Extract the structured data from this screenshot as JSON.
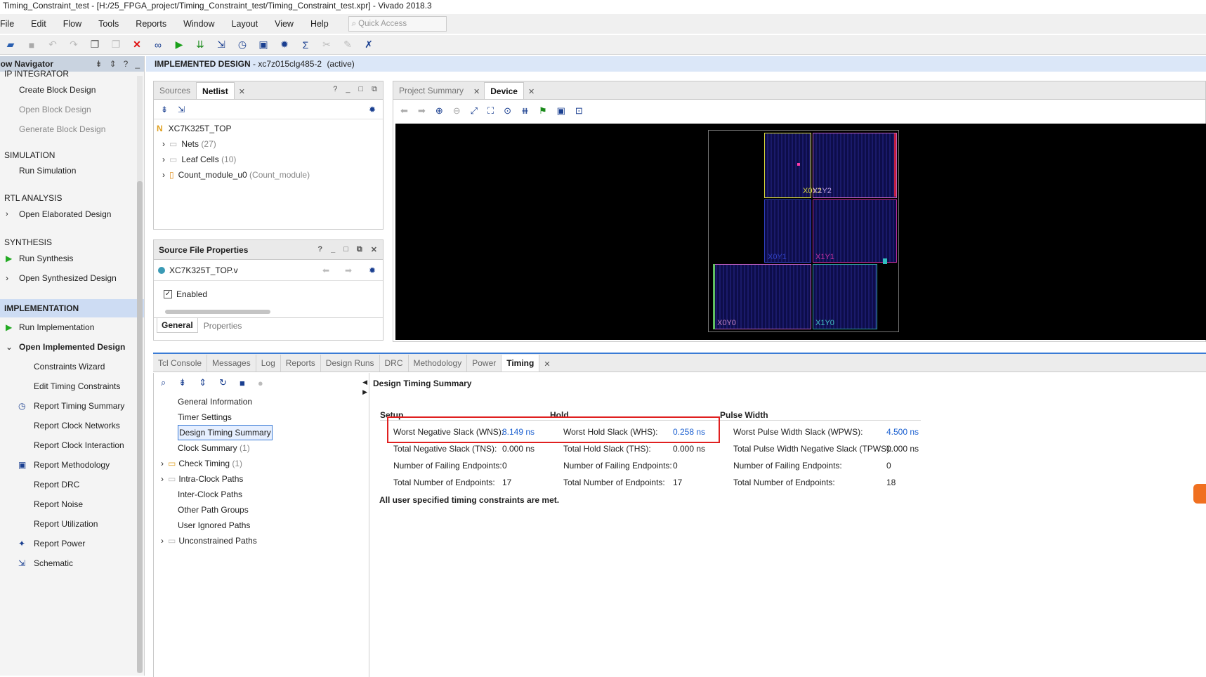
{
  "window": {
    "title": "Timing_Constraint_test - [H:/25_FPGA_project/Timing_Constraint_test/Timing_Constraint_test.xpr] - Vivado 2018.3"
  },
  "menu": [
    "File",
    "Edit",
    "Flow",
    "Tools",
    "Reports",
    "Window",
    "Layout",
    "View",
    "Help"
  ],
  "quick_access": {
    "placeholder": "Quick Access"
  },
  "flow_nav": {
    "title": "Flow Navigator",
    "sections": {
      "ip": "IP INTEGRATOR",
      "sim": "SIMULATION",
      "rtl": "RTL ANALYSIS",
      "syn": "SYNTHESIS",
      "impl": "IMPLEMENTATION"
    },
    "items": {
      "create_bd": "Create Block Design",
      "open_bd": "Open Block Design",
      "gen_bd": "Generate Block Design",
      "run_sim": "Run Simulation",
      "open_elab": "Open Elaborated Design",
      "run_syn": "Run Synthesis",
      "open_syn": "Open Synthesized Design",
      "run_impl": "Run Implementation",
      "open_impl": "Open Implemented Design",
      "constraints_wizard": "Constraints Wizard",
      "edit_timing": "Edit Timing Constraints",
      "report_timing": "Report Timing Summary",
      "report_clock_net": "Report Clock Networks",
      "report_clock_int": "Report Clock Interaction",
      "report_meth": "Report Methodology",
      "report_drc": "Report DRC",
      "report_noise": "Report Noise",
      "report_util": "Report Utilization",
      "report_power": "Report Power",
      "schematic": "Schematic"
    }
  },
  "impl_bar": {
    "label": "IMPLEMENTED DESIGN",
    "part": "- xc7z015clg485-2",
    "status": "(active)"
  },
  "netlist_panel": {
    "tabs": [
      "Sources",
      "Netlist"
    ],
    "top": "XC7K325T_TOP",
    "rows": [
      {
        "name": "Nets",
        "count": "(27)"
      },
      {
        "name": "Leaf Cells",
        "count": "(10)"
      },
      {
        "name": "Count_module_u0",
        "count": "(Count_module)"
      }
    ]
  },
  "props_panel": {
    "title": "Source File Properties",
    "file": "XC7K325T_TOP.v",
    "enabled": "Enabled",
    "tabs": [
      "General",
      "Properties"
    ]
  },
  "device_panel": {
    "tabs": [
      "Project Summary",
      "Device"
    ],
    "regions": [
      "X0Y2",
      "X1Y2",
      "X0Y1",
      "X1Y1",
      "X0Y0",
      "X1Y0"
    ]
  },
  "bottom": {
    "tabs": [
      "Tcl Console",
      "Messages",
      "Log",
      "Reports",
      "Design Runs",
      "DRC",
      "Methodology",
      "Power",
      "Timing"
    ],
    "tree": [
      {
        "label": "General Information",
        "count": "",
        "expand": false
      },
      {
        "label": "Timer Settings",
        "count": "",
        "expand": false
      },
      {
        "label": "Design Timing Summary",
        "count": "",
        "expand": false
      },
      {
        "label": "Clock Summary",
        "count": "(1)",
        "expand": false
      },
      {
        "label": "Check Timing",
        "count": "(1)",
        "expand": true
      },
      {
        "label": "Intra-Clock Paths",
        "count": "",
        "expand": true
      },
      {
        "label": "Inter-Clock Paths",
        "count": "",
        "expand": false
      },
      {
        "label": "Other Path Groups",
        "count": "",
        "expand": false
      },
      {
        "label": "User Ignored Paths",
        "count": "",
        "expand": false
      },
      {
        "label": "Unconstrained Paths",
        "count": "",
        "expand": true
      }
    ],
    "summary_title": "Design Timing Summary",
    "setup": {
      "head": "Setup",
      "rows": [
        {
          "label": "Worst Negative Slack (WNS):",
          "value": "8.149 ns"
        },
        {
          "label": "Total Negative Slack (TNS):",
          "value": "0.000 ns"
        },
        {
          "label": "Number of Failing Endpoints:",
          "value": "0"
        },
        {
          "label": "Total Number of Endpoints:",
          "value": "17"
        }
      ]
    },
    "hold": {
      "head": "Hold",
      "rows": [
        {
          "label": "Worst Hold Slack (WHS):",
          "value": "0.258 ns"
        },
        {
          "label": "Total Hold Slack (THS):",
          "value": "0.000 ns"
        },
        {
          "label": "Number of Failing Endpoints:",
          "value": "0"
        },
        {
          "label": "Total Number of Endpoints:",
          "value": "17"
        }
      ]
    },
    "pulse": {
      "head": "Pulse Width",
      "rows": [
        {
          "label": "Worst Pulse Width Slack (WPWS):",
          "value": "4.500 ns"
        },
        {
          "label": "Total Pulse Width Negative Slack (TPWS):",
          "value": "0.000 ns"
        },
        {
          "label": "Number of Failing Endpoints:",
          "value": "0"
        },
        {
          "label": "Total Number of Endpoints:",
          "value": "18"
        }
      ]
    },
    "met_message": "All user specified timing constraints are met."
  },
  "colors": {
    "accent": "#3a7bd5",
    "highlight_box": "#e02020",
    "link": "#1a5fd0"
  }
}
